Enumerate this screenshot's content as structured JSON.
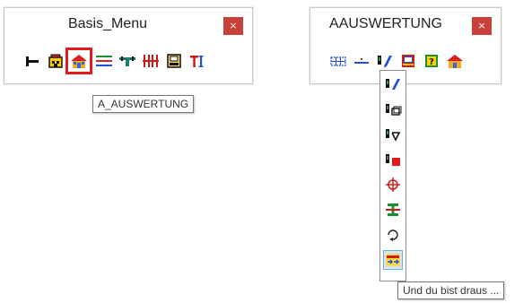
{
  "basis_menu": {
    "title": "Basis_Menu",
    "close_label": "×",
    "tools": [
      {
        "icon": "t-junction-icon"
      },
      {
        "icon": "building-icon"
      },
      {
        "icon": "house-auswertung-icon",
        "selected": true
      },
      {
        "icon": "colored-lines-icon"
      },
      {
        "icon": "pipe-icon"
      },
      {
        "icon": "vertical-bars-icon"
      },
      {
        "icon": "monitor-icon"
      },
      {
        "icon": "text-tool-icon"
      }
    ],
    "tooltip": "A_AUSWERTUNG"
  },
  "auswertung_menu": {
    "title": "AAUSWERTUNG",
    "close_label": "×",
    "tools": [
      {
        "icon": "grid-icon"
      },
      {
        "icon": "minus-icon"
      },
      {
        "icon": "edit-pencil-icon"
      },
      {
        "icon": "window-red-icon"
      },
      {
        "icon": "help-question-icon"
      },
      {
        "icon": "house-icon"
      }
    ],
    "dropdown": [
      {
        "icon": "edit-pencil-icon"
      },
      {
        "icon": "copy-box-icon"
      },
      {
        "icon": "flag-play-icon"
      },
      {
        "icon": "red-block-icon"
      },
      {
        "icon": "crosshair-icon"
      },
      {
        "icon": "i-beam-icon"
      },
      {
        "icon": "rotate-icon"
      },
      {
        "icon": "exit-arrows-icon",
        "hover": true
      }
    ],
    "tooltip": "Und du bist draus ..."
  },
  "colors": {
    "close_red": "#c7403a",
    "selection_red": "#e11b1b",
    "hover_blue": "#cfe6fb"
  }
}
